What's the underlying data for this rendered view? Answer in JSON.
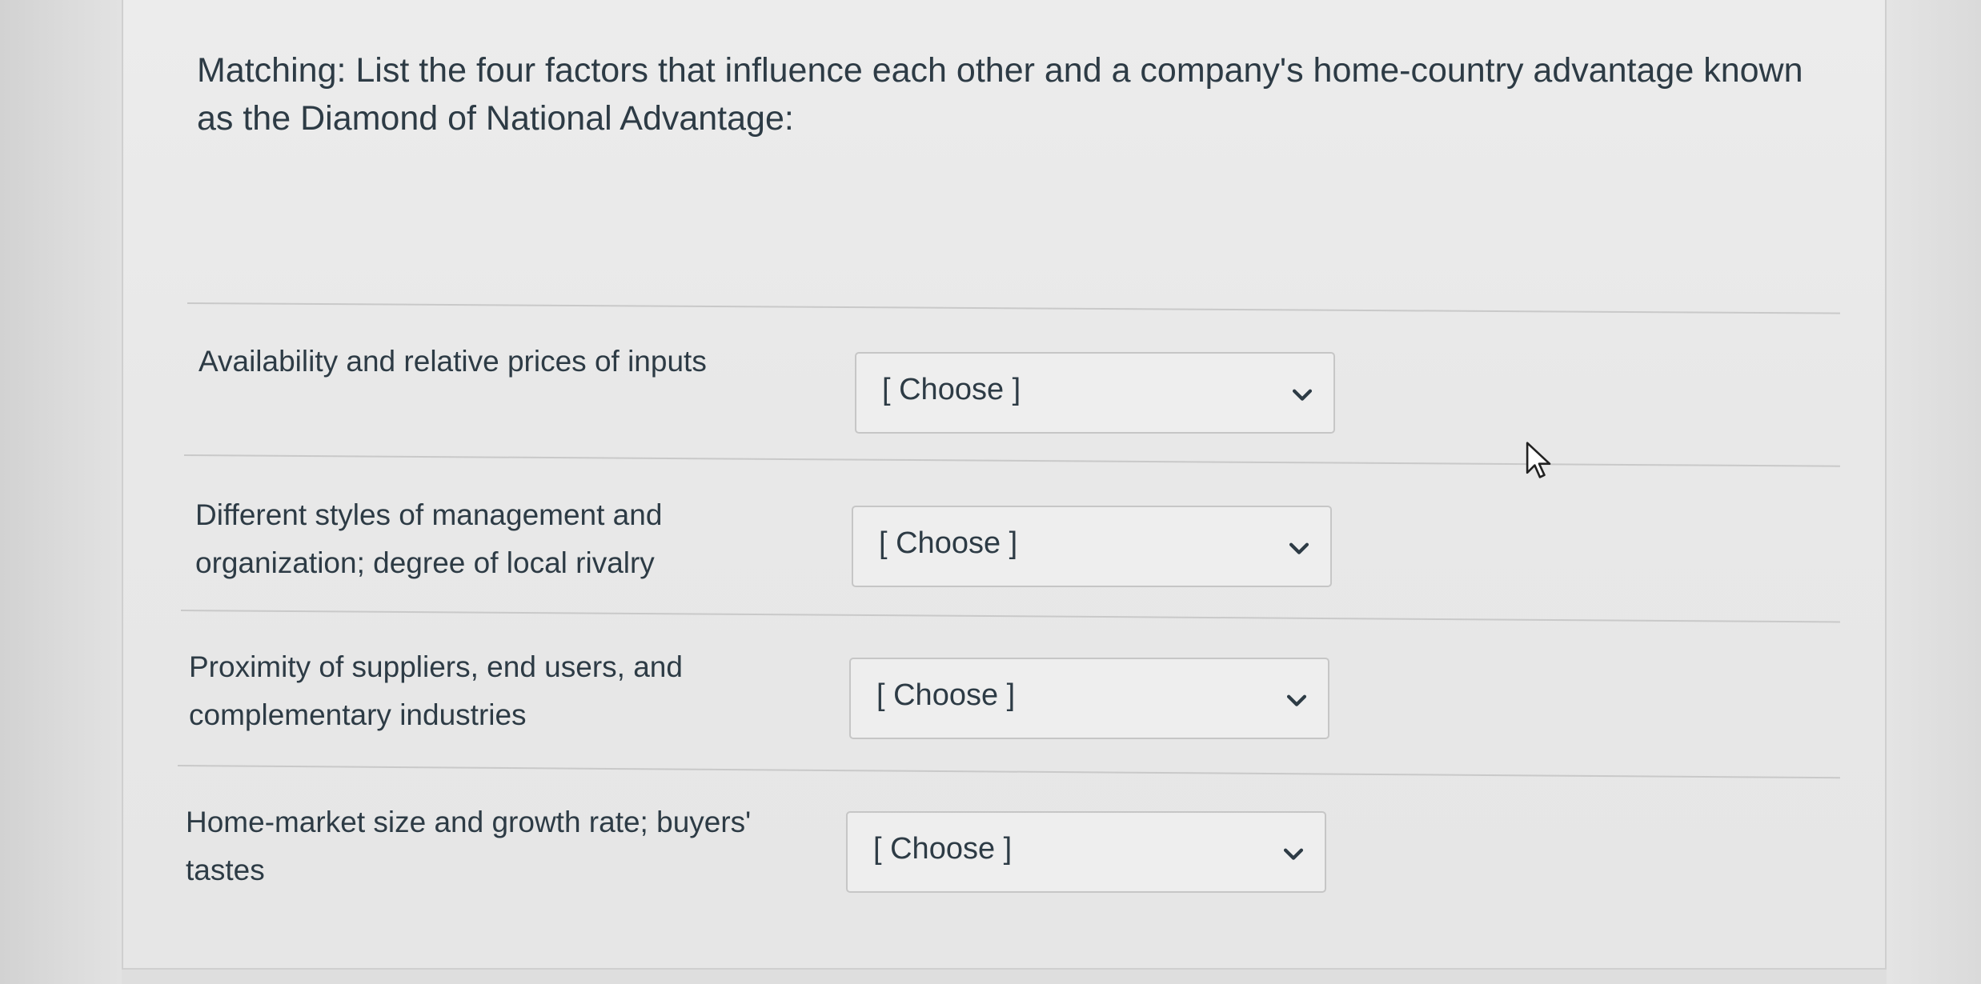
{
  "question": {
    "text": "Matching: List the four factors that influence each other and a company's home-country advantage known as the Diamond of National Advantage:"
  },
  "items": [
    {
      "prompt": "Availability and relative prices of inputs",
      "selected": "[ Choose ]"
    },
    {
      "prompt": "Different styles of management and organization; degree of local rivalry",
      "selected": "[ Choose ]"
    },
    {
      "prompt": "Proximity of suppliers, end users, and complementary industries",
      "selected": "[ Choose ]"
    },
    {
      "prompt": "Home-market size and growth rate; buyers' tastes",
      "selected": "[ Choose ]"
    }
  ],
  "icons": {
    "dropdown": "chevron-down-icon",
    "cursor": "mouse-pointer-icon"
  },
  "colors": {
    "text": "#2d3b45",
    "card_background": "#e9e9e9",
    "divider": "#c9c9c9",
    "select_border": "#c6c6c6"
  }
}
